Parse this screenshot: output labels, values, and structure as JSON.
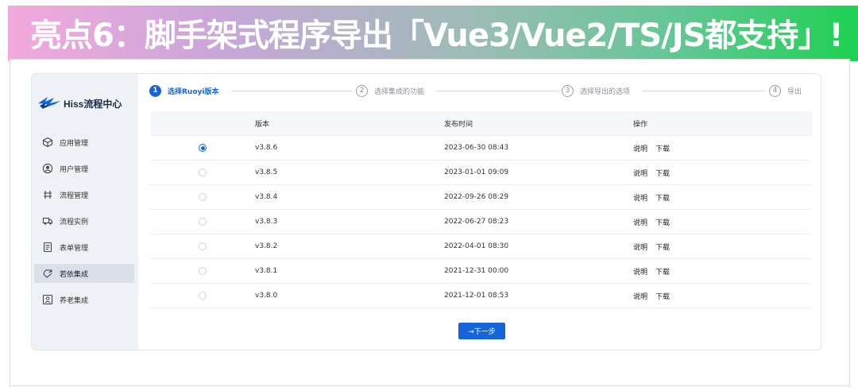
{
  "banner": {
    "title": "亮点6：脚手架式程序导出「Vue3/Vue2/TS/JS都支持」!"
  },
  "app": {
    "logo_text": "Hiss流程中心"
  },
  "sidebar": {
    "items": [
      {
        "label": "应用管理",
        "icon": "cube-icon",
        "active": false
      },
      {
        "label": "用户管理",
        "icon": "user-circle-icon",
        "active": false
      },
      {
        "label": "流程管理",
        "icon": "flow-icon",
        "active": false
      },
      {
        "label": "流程实例",
        "icon": "truck-icon",
        "active": false
      },
      {
        "label": "表单管理",
        "icon": "form-icon",
        "active": false
      },
      {
        "label": "若依集成",
        "icon": "integration-icon",
        "active": true
      },
      {
        "label": "养老集成",
        "icon": "person-card-icon",
        "active": false
      }
    ]
  },
  "steps": [
    {
      "num": "1",
      "label": "选择Ruoyi版本",
      "active": true
    },
    {
      "num": "2",
      "label": "选择集成的功能",
      "active": false
    },
    {
      "num": "3",
      "label": "选择导出的选项",
      "active": false
    },
    {
      "num": "4",
      "label": "导出",
      "active": false
    }
  ],
  "table": {
    "headers": {
      "version": "版本",
      "time": "发布时间",
      "ops": "操作"
    },
    "rows": [
      {
        "version": "v3.8.6",
        "time": "2023-06-30 08:43",
        "selected": true
      },
      {
        "version": "v3.8.5",
        "time": "2023-01-01 09:09",
        "selected": false
      },
      {
        "version": "v3.8.4",
        "time": "2022-09-26 08:29",
        "selected": false
      },
      {
        "version": "v3.8.3",
        "time": "2022-06-27 08:23",
        "selected": false
      },
      {
        "version": "v3.8.2",
        "time": "2022-04-01 08:30",
        "selected": false
      },
      {
        "version": "v3.8.1",
        "time": "2021-12-31 00:00",
        "selected": false
      },
      {
        "version": "v3.8.0",
        "time": "2021-12-01 08:53",
        "selected": false
      }
    ],
    "op_desc": "说明",
    "op_download": "下载"
  },
  "next_button": {
    "label": "→下一步"
  },
  "colors": {
    "primary": "#1565d8",
    "sidebar_bg": "#eef1f6",
    "header_bg": "#f5f7fa"
  }
}
